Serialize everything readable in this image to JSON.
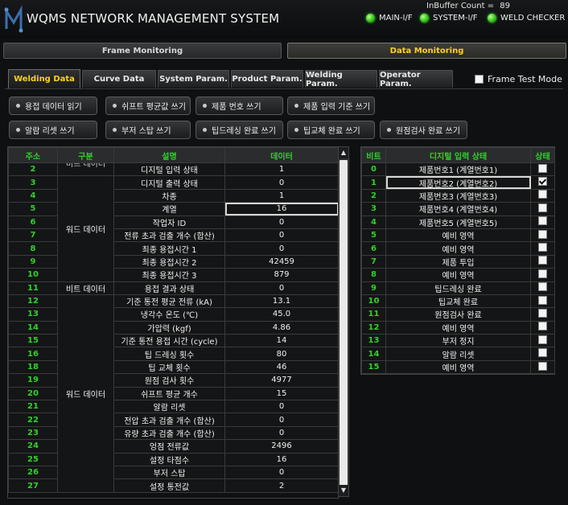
{
  "app": {
    "title": "WQMS NETWORK MANAGEMENT SYSTEM",
    "inbuffer_label": "InBuffer Count =",
    "inbuffer_value": "89"
  },
  "status_indicators": [
    {
      "label": "MAIN-I/F",
      "color": "#31c41a"
    },
    {
      "label": "SYSTEM-I/F",
      "color": "#31c41a"
    },
    {
      "label": "WELD CHECKER",
      "color": "#31c41a"
    }
  ],
  "modes": {
    "frame": "Frame Monitoring",
    "data": "Data Monitoring",
    "active": "data"
  },
  "tabs": [
    "Welding Data",
    "Curve Data",
    "System Param.",
    "Product Param.",
    "Welding Param.",
    "Operator Param."
  ],
  "active_tab": "Welding Data",
  "frame_test": {
    "label": "Frame Test Mode",
    "checked": false
  },
  "action_buttons_row1": [
    "용접 데이터 읽기",
    "쉬프트 평균값 쓰기",
    "제품 번호 쓰기",
    "제품 입력 기준 쓰기"
  ],
  "action_buttons_row2": [
    "알람 리셋 쓰기",
    "부저 스탑 쓰기",
    "팁드레싱 완료 쓰기",
    "팁교체 완료 쓰기",
    "원점검사 완료 쓰기"
  ],
  "left_table": {
    "headers": [
      "주소",
      "구분",
      "설명",
      "데이터"
    ],
    "partial_group_label": "비트 데이터",
    "groups": [
      {
        "label": "워드 데이터",
        "rows": 8
      },
      {
        "label": "비트 데이터",
        "rows": 1
      },
      {
        "label": "워드 데이터",
        "rows": 16
      }
    ],
    "rows": [
      {
        "addr": "2",
        "desc": "디지털 입력 상태",
        "data": "1"
      },
      {
        "addr": "3",
        "desc": "디지털 출력 상태",
        "data": "0"
      },
      {
        "addr": "4",
        "desc": "차종",
        "data": "1"
      },
      {
        "addr": "5",
        "desc": "계열",
        "data": "16"
      },
      {
        "addr": "6",
        "desc": "작업자 ID",
        "data": "0"
      },
      {
        "addr": "7",
        "desc": "전류 초과 검출 개수 (합산)",
        "data": "0"
      },
      {
        "addr": "8",
        "desc": "최종 용접시간 1",
        "data": "0"
      },
      {
        "addr": "9",
        "desc": "최종 용접시간 2",
        "data": "42459"
      },
      {
        "addr": "10",
        "desc": "최종 용접시간 3",
        "data": "879"
      },
      {
        "addr": "11",
        "desc": "용접 결과 상태",
        "data": "0"
      },
      {
        "addr": "12",
        "desc": "기준 통전 평균 전류 (kA)",
        "data": "13.1"
      },
      {
        "addr": "13",
        "desc": "냉각수 온도 (℃)",
        "data": "45.0"
      },
      {
        "addr": "14",
        "desc": "가압력 (kgf)",
        "data": "4.86"
      },
      {
        "addr": "15",
        "desc": "기준 통전 용접 시간 (cycle)",
        "data": "14"
      },
      {
        "addr": "16",
        "desc": "팁 드레싱 횟수",
        "data": "80"
      },
      {
        "addr": "18",
        "desc": "팁 교체 횟수",
        "data": "46"
      },
      {
        "addr": "19",
        "desc": "원점 검사 횟수",
        "data": "4977"
      },
      {
        "addr": "20",
        "desc": "쉬프트 평균 개수",
        "data": "15"
      },
      {
        "addr": "21",
        "desc": "알람 리셋",
        "data": "0"
      },
      {
        "addr": "22",
        "desc": "전압 초과 검출 개수 (합산)",
        "data": "0"
      },
      {
        "addr": "23",
        "desc": "유량 초과 검출 개수 (합산)",
        "data": "0"
      },
      {
        "addr": "24",
        "desc": "엉점 전류값",
        "data": "2496"
      },
      {
        "addr": "25",
        "desc": "설정 타점수",
        "data": "16"
      },
      {
        "addr": "26",
        "desc": "부저 스탑",
        "data": "0"
      },
      {
        "addr": "27",
        "desc": "설정 통전값",
        "data": "2"
      }
    ]
  },
  "right_table": {
    "headers": [
      "비트",
      "디지털 입력 상태",
      "상태"
    ],
    "rows": [
      {
        "bit": "0",
        "label": "제품번호1 (계열번호1)",
        "checked": false
      },
      {
        "bit": "1",
        "label": "제품번호2 (계열번호2)",
        "checked": true
      },
      {
        "bit": "2",
        "label": "제품번호3 (계열번호3)",
        "checked": false
      },
      {
        "bit": "3",
        "label": "제품번호4 (계열번호4)",
        "checked": false
      },
      {
        "bit": "4",
        "label": "제품번호5 (계열번호5)",
        "checked": false
      },
      {
        "bit": "5",
        "label": "예비 영역",
        "checked": false
      },
      {
        "bit": "6",
        "label": "예비 영역",
        "checked": false
      },
      {
        "bit": "7",
        "label": "제품 투입",
        "checked": false
      },
      {
        "bit": "8",
        "label": "예비 영역",
        "checked": false
      },
      {
        "bit": "9",
        "label": "팁드레싱 완료",
        "checked": false
      },
      {
        "bit": "10",
        "label": "팁교체 완료",
        "checked": false
      },
      {
        "bit": "11",
        "label": "원점검사 완료",
        "checked": false
      },
      {
        "bit": "12",
        "label": "예비 영역",
        "checked": false
      },
      {
        "bit": "13",
        "label": "부저 정지",
        "checked": false
      },
      {
        "bit": "14",
        "label": "알람 리셋",
        "checked": false
      },
      {
        "bit": "15",
        "label": "예비 영역",
        "checked": false
      }
    ]
  }
}
